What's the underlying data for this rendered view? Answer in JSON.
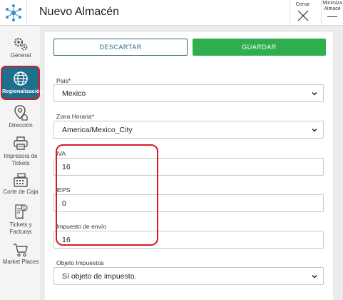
{
  "header": {
    "title": "Nuevo Almacén",
    "close_label": "Cerrar",
    "minimize_label_line1": "Minimiza",
    "minimize_label_line2": "Almacé"
  },
  "sidebar": {
    "items": [
      {
        "label": "General",
        "icon": "gears-icon"
      },
      {
        "label": "Regionalización",
        "icon": "globe-icon",
        "active": true
      },
      {
        "label": "Dirección",
        "icon": "location-icon"
      },
      {
        "label_line1": "Impresora de",
        "label_line2": "Tickets",
        "icon": "printer-icon"
      },
      {
        "label": "Corte de Caja",
        "icon": "cash-register-icon"
      },
      {
        "label_line1": "Tickets y",
        "label_line2": "Facturas",
        "icon": "invoice-icon"
      },
      {
        "label": "Market Places",
        "icon": "cart-icon"
      }
    ]
  },
  "actions": {
    "discard_label": "DESCARTAR",
    "save_label": "GUARDAR"
  },
  "form": {
    "pais": {
      "label": "País*",
      "value": "Mexico"
    },
    "zona": {
      "label": "Zona Horaria*",
      "value": "America/Mexico_City"
    },
    "iva": {
      "label": "IVA",
      "value": "16"
    },
    "ieps": {
      "label": "IEPS",
      "value": "0"
    },
    "envio": {
      "label": "Impuesto de envío",
      "value": "16"
    },
    "objeto": {
      "label": "Objeto Impuestos",
      "value": "Sí objeto de impuesto."
    }
  },
  "colors": {
    "primary": "#1f6e8c",
    "save": "#2eae4e",
    "highlight": "#d81b2a"
  }
}
